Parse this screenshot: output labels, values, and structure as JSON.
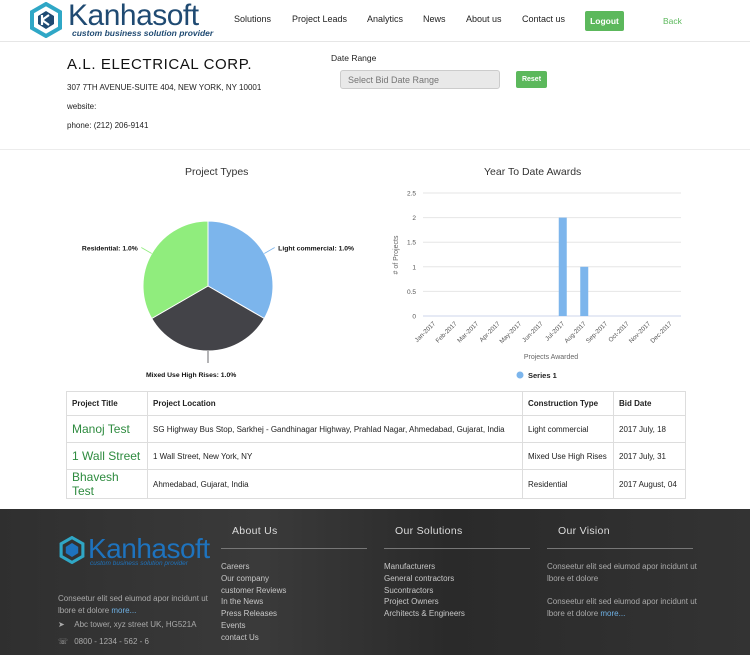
{
  "header": {
    "logo_text": "Kanhasoft",
    "logo_tagline": "custom business solution provider",
    "nav": [
      "Solutions",
      "Project Leads",
      "Analytics",
      "News",
      "About us",
      "Contact us"
    ],
    "logout_label": "Logout",
    "back_label": "Back"
  },
  "company": {
    "name": "A.L. ELECTRICAL CORP.",
    "address": "307 7TH AVENUE-SUITE 404, NEW YORK, NY 10001",
    "website": "website:",
    "phone": "phone: (212) 206-9141"
  },
  "filter": {
    "label": "Date Range",
    "placeholder": "Select Bid Date Range",
    "reset_label": "Reset"
  },
  "project_types": {
    "title": "Project Types",
    "labels": [
      "Light commercial: 1.0%",
      "Mixed Use High Rises: 1.0%",
      "Residential: 1.0%"
    ]
  },
  "ytd": {
    "title": "Year To Date Awards"
  },
  "chart_data": [
    {
      "type": "pie",
      "title": "Project Types",
      "categories": [
        "Light commercial",
        "Mixed Use High Rises",
        "Residential"
      ],
      "values": [
        1.0,
        1.0,
        1.0
      ],
      "colors": [
        "#7cb5ec",
        "#434348",
        "#90ed7d"
      ]
    },
    {
      "type": "bar",
      "title": "Year To Date Awards",
      "categories": [
        "Jan-2017",
        "Feb-2017",
        "Mar-2017",
        "Apr-2017",
        "May-2017",
        "Jun-2017",
        "Jul-2017",
        "Aug-2017",
        "Sep-2017",
        "Oct-2017",
        "Nov-2017",
        "Dec-2017"
      ],
      "series": [
        {
          "name": "Series 1",
          "values": [
            0,
            0,
            0,
            0,
            0,
            0,
            2,
            1,
            0,
            0,
            0,
            0
          ]
        }
      ],
      "ylabel": "# of Projects",
      "xlabel": "Projects Awarded",
      "yticks": [
        "0",
        "0.5",
        "1",
        "1.5",
        "2",
        "2.5"
      ],
      "ylim": [
        0,
        2.5
      ],
      "grid": true,
      "legend": "bottom",
      "color": "#7cb5ec"
    }
  ],
  "table": {
    "headers": [
      "Project Title",
      "Project Location",
      "Construction Type",
      "Bid Date"
    ],
    "rows": [
      [
        "Manoj Test",
        "SG Highway Bus Stop, Sarkhej - Gandhinagar Highway, Prahlad Nagar, Ahmedabad, Gujarat, India",
        "Light commercial",
        "2017 July, 18"
      ],
      [
        "1 Wall Street",
        "1 Wall Street, New York, NY",
        "Mixed Use High Rises",
        "2017 July, 31"
      ],
      [
        "Bhavesh Test",
        "Ahmedabad, Gujarat, India",
        "Residential",
        "2017 August, 04"
      ]
    ]
  },
  "footer": {
    "logo_text": "Kanhasoft",
    "logo_tagline": "custom business solution provider",
    "blurb": "Conseetur elit sed eiumod apor incidunt ut lbore et dolore",
    "more": "more...",
    "address": "Abc tower, xyz street UK, HG521A",
    "phone": "0800 - 1234 - 562 - 6",
    "about_heading": "About Us",
    "about_links": [
      "Careers",
      "Our company",
      "customer Reviews",
      "In the News",
      "Press Releases",
      "Events",
      "contact Us"
    ],
    "solutions_heading": "Our Solutions",
    "solutions_links": [
      "Manufacturers",
      "General contractors",
      "Sucontractors",
      "Project Owners",
      "Architects & Engineers"
    ],
    "vision_heading": "Our Vision",
    "vision_text_1": "Conseetur elit sed eiumod apor incidunt ut lbore et dolore",
    "vision_text_2": "Conseetur elit sed eiumod apor incidunt ut lbore et dolore",
    "vision_more": "more..."
  },
  "colors": {
    "accent_green": "#5cb85c",
    "brand_blue": "#1f4a72",
    "footer_bg": "#333333"
  }
}
